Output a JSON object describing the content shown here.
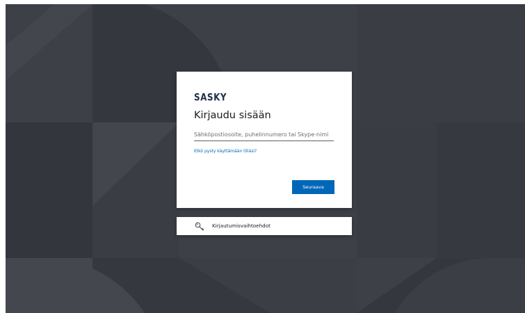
{
  "colors": {
    "background": "#3d4047",
    "card": "#ffffff",
    "accent": "#0067b8",
    "logo": "#1f2f4b"
  },
  "brand": {
    "logo_text": "SASKY"
  },
  "signin": {
    "title": "Kirjaudu sisään",
    "email_placeholder": "Sähköpostiosoite, puhelinnumero tai Skype-nimi",
    "email_value": "",
    "cant_access_link": "Etkö pysty käyttämään tiliäsi?",
    "next_button": "Seuraava"
  },
  "signin_options": {
    "icon": "key-icon",
    "label": "Kirjautumisvaihtoehdot"
  }
}
